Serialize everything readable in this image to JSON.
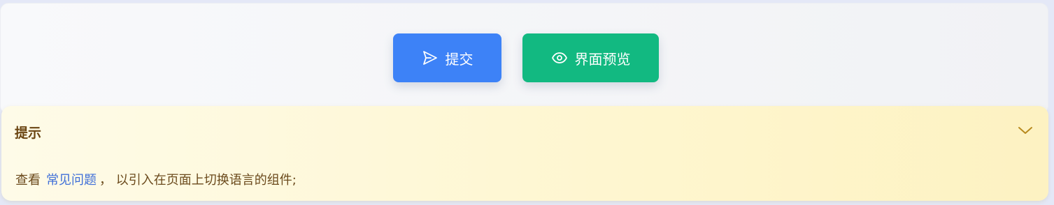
{
  "actions": {
    "submit_label": "提交",
    "submit_icon": "send-icon",
    "preview_label": "界面预览",
    "preview_icon": "eye-icon",
    "submit_color": "#3d82f7",
    "preview_color": "#12b981"
  },
  "tip": {
    "title": "提示",
    "text_before": "查看",
    "link_text": "常见问题",
    "text_after": "， 以引入在页面上切换语言的组件;",
    "collapse_icon": "chevron-down-icon",
    "title_color": "#6b4512",
    "link_color": "#3f6fd8"
  }
}
